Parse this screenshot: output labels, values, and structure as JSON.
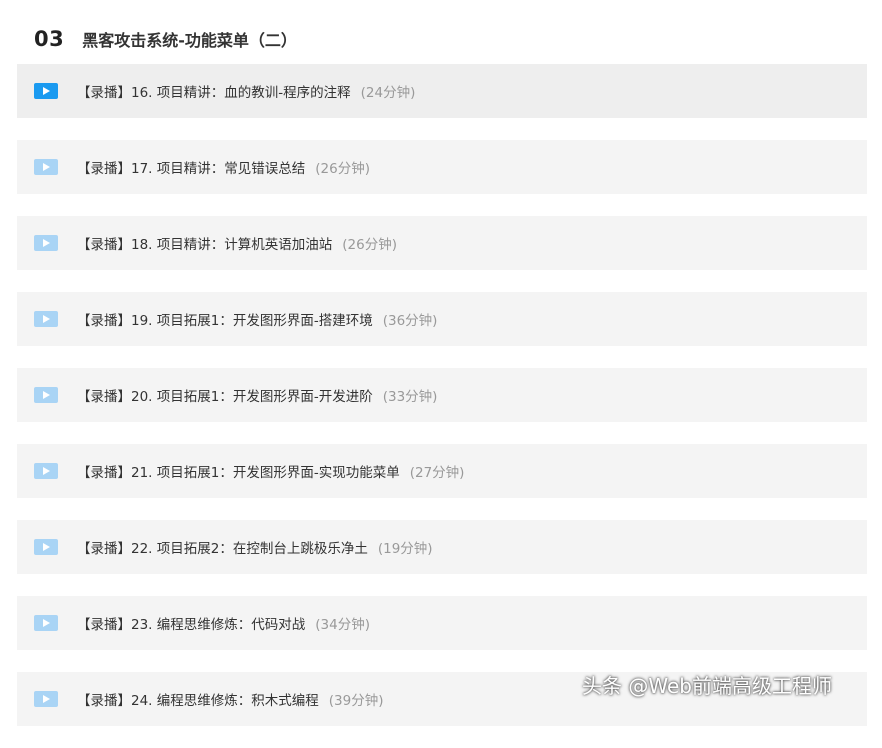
{
  "section": {
    "number": "03",
    "title": "黑客攻击系统-功能菜单（二）"
  },
  "lessons": [
    {
      "label": "【录播】16. 项目精讲：血的教训-程序的注释",
      "duration": "(24分钟)"
    },
    {
      "label": "【录播】17. 项目精讲：常见错误总结",
      "duration": "(26分钟)"
    },
    {
      "label": "【录播】18. 项目精讲：计算机英语加油站",
      "duration": "(26分钟)"
    },
    {
      "label": "【录播】19. 项目拓展1：开发图形界面-搭建环境",
      "duration": "(36分钟)"
    },
    {
      "label": "【录播】20. 项目拓展1：开发图形界面-开发进阶",
      "duration": "(33分钟)"
    },
    {
      "label": "【录播】21. 项目拓展1：开发图形界面-实现功能菜单",
      "duration": "(27分钟)"
    },
    {
      "label": "【录播】22. 项目拓展2：在控制台上跳极乐净土",
      "duration": "(19分钟)"
    },
    {
      "label": "【录播】23. 编程思维修炼：代码对战",
      "duration": "(34分钟)"
    },
    {
      "label": "【录播】24. 编程思维修炼：积木式编程",
      "duration": "(39分钟)"
    }
  ],
  "watermark": "头条 @Web前端高级工程师",
  "icons": {
    "lesson": "play-video-icon"
  },
  "colors": {
    "active_icon": "#1a9af0",
    "inactive_icon": "#a9d4f5",
    "row_bg": "#f4f4f4"
  }
}
